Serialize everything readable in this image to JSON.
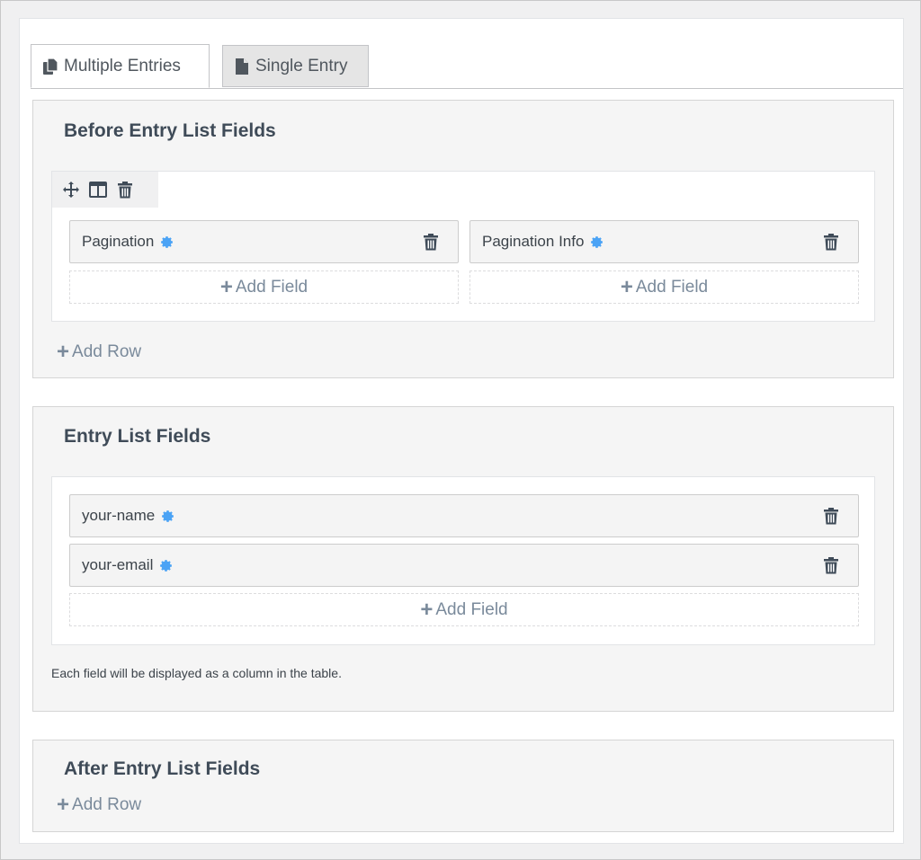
{
  "tabs": [
    {
      "label": "Multiple Entries",
      "icon": "copy-icon",
      "active": true
    },
    {
      "label": "Single Entry",
      "icon": "file-icon",
      "active": false
    }
  ],
  "sections": {
    "before": {
      "title": "Before Entry List Fields",
      "columns": [
        {
          "field": "Pagination",
          "add_label": "Add Field"
        },
        {
          "field": "Pagination Info",
          "add_label": "Add Field"
        }
      ],
      "add_row_label": "Add Row"
    },
    "entry_list": {
      "title": "Entry List Fields",
      "fields": [
        "your-name",
        "your-email"
      ],
      "add_label": "Add Field",
      "note": "Each field will be displayed as a column in the table."
    },
    "after": {
      "title": "After Entry List Fields",
      "add_row_label": "Add Row"
    }
  },
  "colors": {
    "gear": "#4ba3f5",
    "icon_dark": "#3f4b58",
    "add_text": "#7a8a9b"
  }
}
